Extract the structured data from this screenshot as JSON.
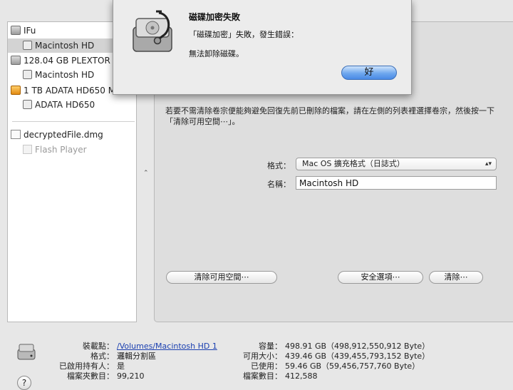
{
  "sidebar": {
    "items": [
      {
        "label": "IFu"
      },
      {
        "label": "Macintosh HD"
      },
      {
        "label": "128.04 GB PLEXTOR P..."
      },
      {
        "label": "Macintosh HD"
      },
      {
        "label": "1 TB ADATA HD650 M..."
      },
      {
        "label": "ADATA HD650"
      },
      {
        "label": "decryptedFile.dmg"
      },
      {
        "label": "Flash Player"
      }
    ]
  },
  "main": {
    "tabs": [
      "",
      "",
      ""
    ],
    "info_lines": [
      "",
      "",
      "",
      "",
      ""
    ],
    "info_text": "若要不需清除卷宗便能夠避免回復先前已刪除的檔案，請在左側的列表裡選擇卷宗，然後按一下「清除可用空間⋯」。",
    "format_label": "格式：",
    "format_value": "Mac OS 擴充格式（日誌式）",
    "name_label": "名稱：",
    "name_value": "Macintosh HD",
    "erase_free_space_button": "清除可用空間⋯",
    "security_options_button": "安全選項⋯",
    "erase_button": "清除⋯",
    "splitter_glyph": "⌃"
  },
  "details": {
    "mount_point_label": "裝載點：",
    "mount_point_value": "/Volumes/Macintosh HD 1",
    "format_label": "格式：",
    "format_value": "邏輯分割區",
    "owners_enabled_label": "已啟用持有人：",
    "owners_enabled_value": "是",
    "folder_count_label": "檔案夾數目：",
    "folder_count_value": "99,210",
    "capacity_label": "容量：",
    "capacity_value": "498.91 GB（498,912,550,912 Byte）",
    "available_label": "可用大小：",
    "available_value": "439.46 GB（439,455,793,152 Byte）",
    "used_label": "已使用：",
    "used_value": "59.46 GB（59,456,757,760 Byte）",
    "file_count_label": "檔案數目：",
    "file_count_value": "412,588",
    "help_label": "?"
  },
  "alert": {
    "title": "磁碟加密失敗",
    "message": "「磁碟加密」失敗，發生錯誤：",
    "detail": "無法卸除磁碟。",
    "ok_button": "好"
  },
  "colors": {
    "accent": "#4a8ae6",
    "link": "#1a3fb0"
  },
  "icons": {
    "alert": "disk-utility-stethoscope-icon",
    "disk": "hard-disk-icon",
    "volume": "volume-icon",
    "external": "external-disk-icon",
    "image": "disk-image-icon"
  }
}
